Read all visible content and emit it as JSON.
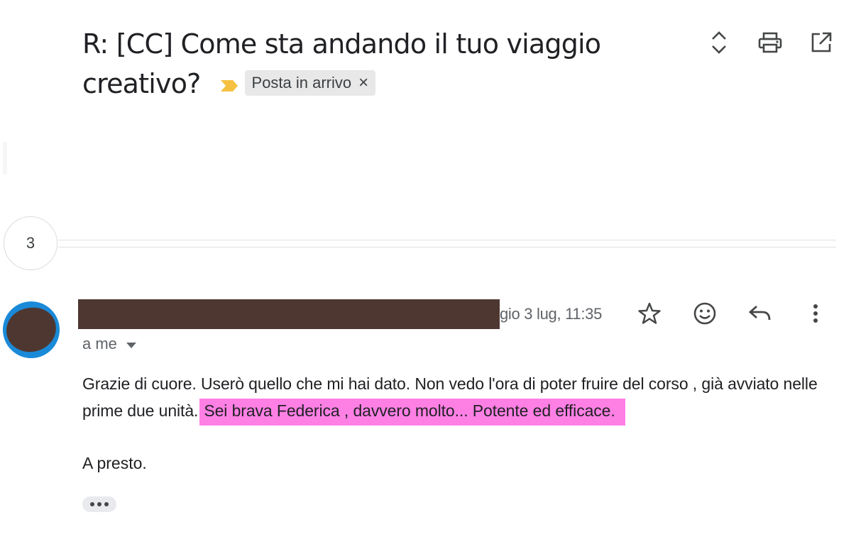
{
  "thread": {
    "subject": "R: [CC] Come sta andando il tuo viaggio creativo?",
    "label": "Posta in arrivo",
    "label_remove": "×",
    "collapsed_count": "3"
  },
  "toolbar": {
    "icons": [
      "expand-collapse-icon",
      "print-icon",
      "open-in-new-window-icon"
    ]
  },
  "message": {
    "date": "gio 3 lug, 11:35",
    "recipient": "a me",
    "body_line": "Grazie di cuore. Userò quello che mi hai dato. Non vedo l'ora di poter fruire del corso , già avviato nelle prime due unità.",
    "highlighted": "Sei brava Federica , davvero molto... Potente ed efficace.",
    "closing": "A presto.",
    "actions": [
      "star-icon",
      "emoji-react-icon",
      "reply-icon",
      "more-vert-icon"
    ]
  },
  "colors": {
    "highlight": "#ff80e5",
    "avatar_ring": "#1a8ad8",
    "redaction": "#4e3731",
    "importance_marker": "#f6c142"
  }
}
